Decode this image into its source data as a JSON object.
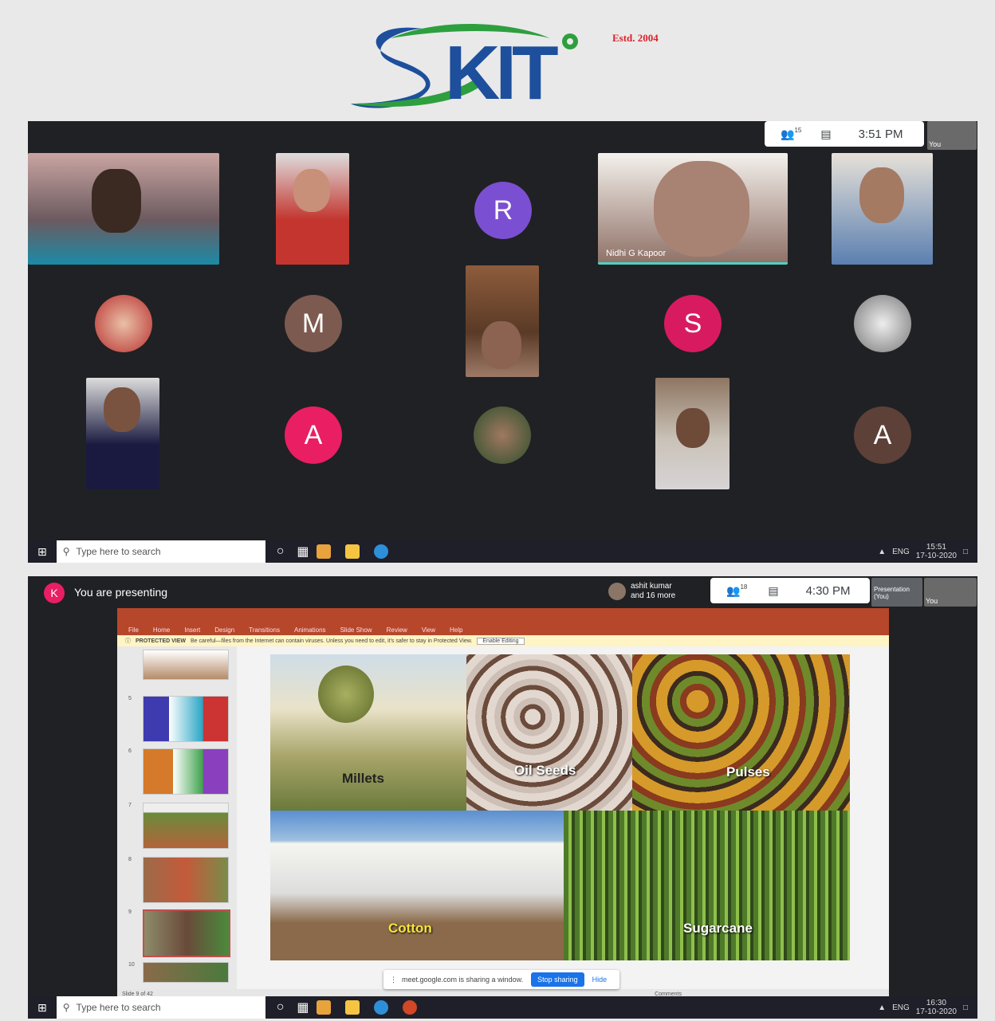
{
  "logo": {
    "estd": "Estd. 2004",
    "letters": "KIT"
  },
  "top_meeting": {
    "participants_count": "15",
    "time": "3:51 PM",
    "self_label": "You",
    "avatars": [
      {
        "letter": "R",
        "color": "#7b4fd1"
      },
      {
        "letter": "M",
        "color": "#7d5a4f"
      },
      {
        "letter": "S",
        "color": "#d81b60"
      },
      {
        "letter": "A",
        "color": "#e91e63"
      },
      {
        "letter": "A",
        "color": "#5d4037"
      }
    ],
    "speaker_name": "Nidhi G Kapoor"
  },
  "top_taskbar": {
    "search_placeholder": "Type here to search",
    "lang": "ENG",
    "time": "15:51",
    "date": "17-10-2020"
  },
  "bottom_meeting": {
    "presenter_initial": "K",
    "presenting_text": "You are presenting",
    "viewer_name": "ashit kumar",
    "viewer_more": "and 16 more",
    "participants_count": "18",
    "time": "4:30 PM",
    "presentation_tile": "Presentation (You)",
    "self_label": "You"
  },
  "powerpoint": {
    "tabs": [
      "File",
      "Home",
      "Insert",
      "Design",
      "Transitions",
      "Animations",
      "Slide Show",
      "Review",
      "View",
      "Help"
    ],
    "protected_label": "PROTECTED VIEW",
    "protected_msg": "Be careful—files from the Internet can contain viruses. Unless you need to edit, it's safer to stay in Protected View.",
    "enable_editing": "Enable Editing",
    "thumb_numbers": [
      "5",
      "6",
      "7",
      "8",
      "9",
      "10"
    ],
    "slide_labels": [
      "Millets",
      "Oil Seeds",
      "Pulses",
      "Cotton",
      "Sugarcane"
    ],
    "status": "Slide 9 of 42",
    "notes": "Comments"
  },
  "share_bar": {
    "msg": "meet.google.com is sharing a window.",
    "stop": "Stop sharing",
    "hide": "Hide"
  },
  "bottom_taskbar": {
    "search_placeholder": "Type here to search",
    "lang": "ENG",
    "time": "16:30",
    "date": "17-10-2020"
  }
}
